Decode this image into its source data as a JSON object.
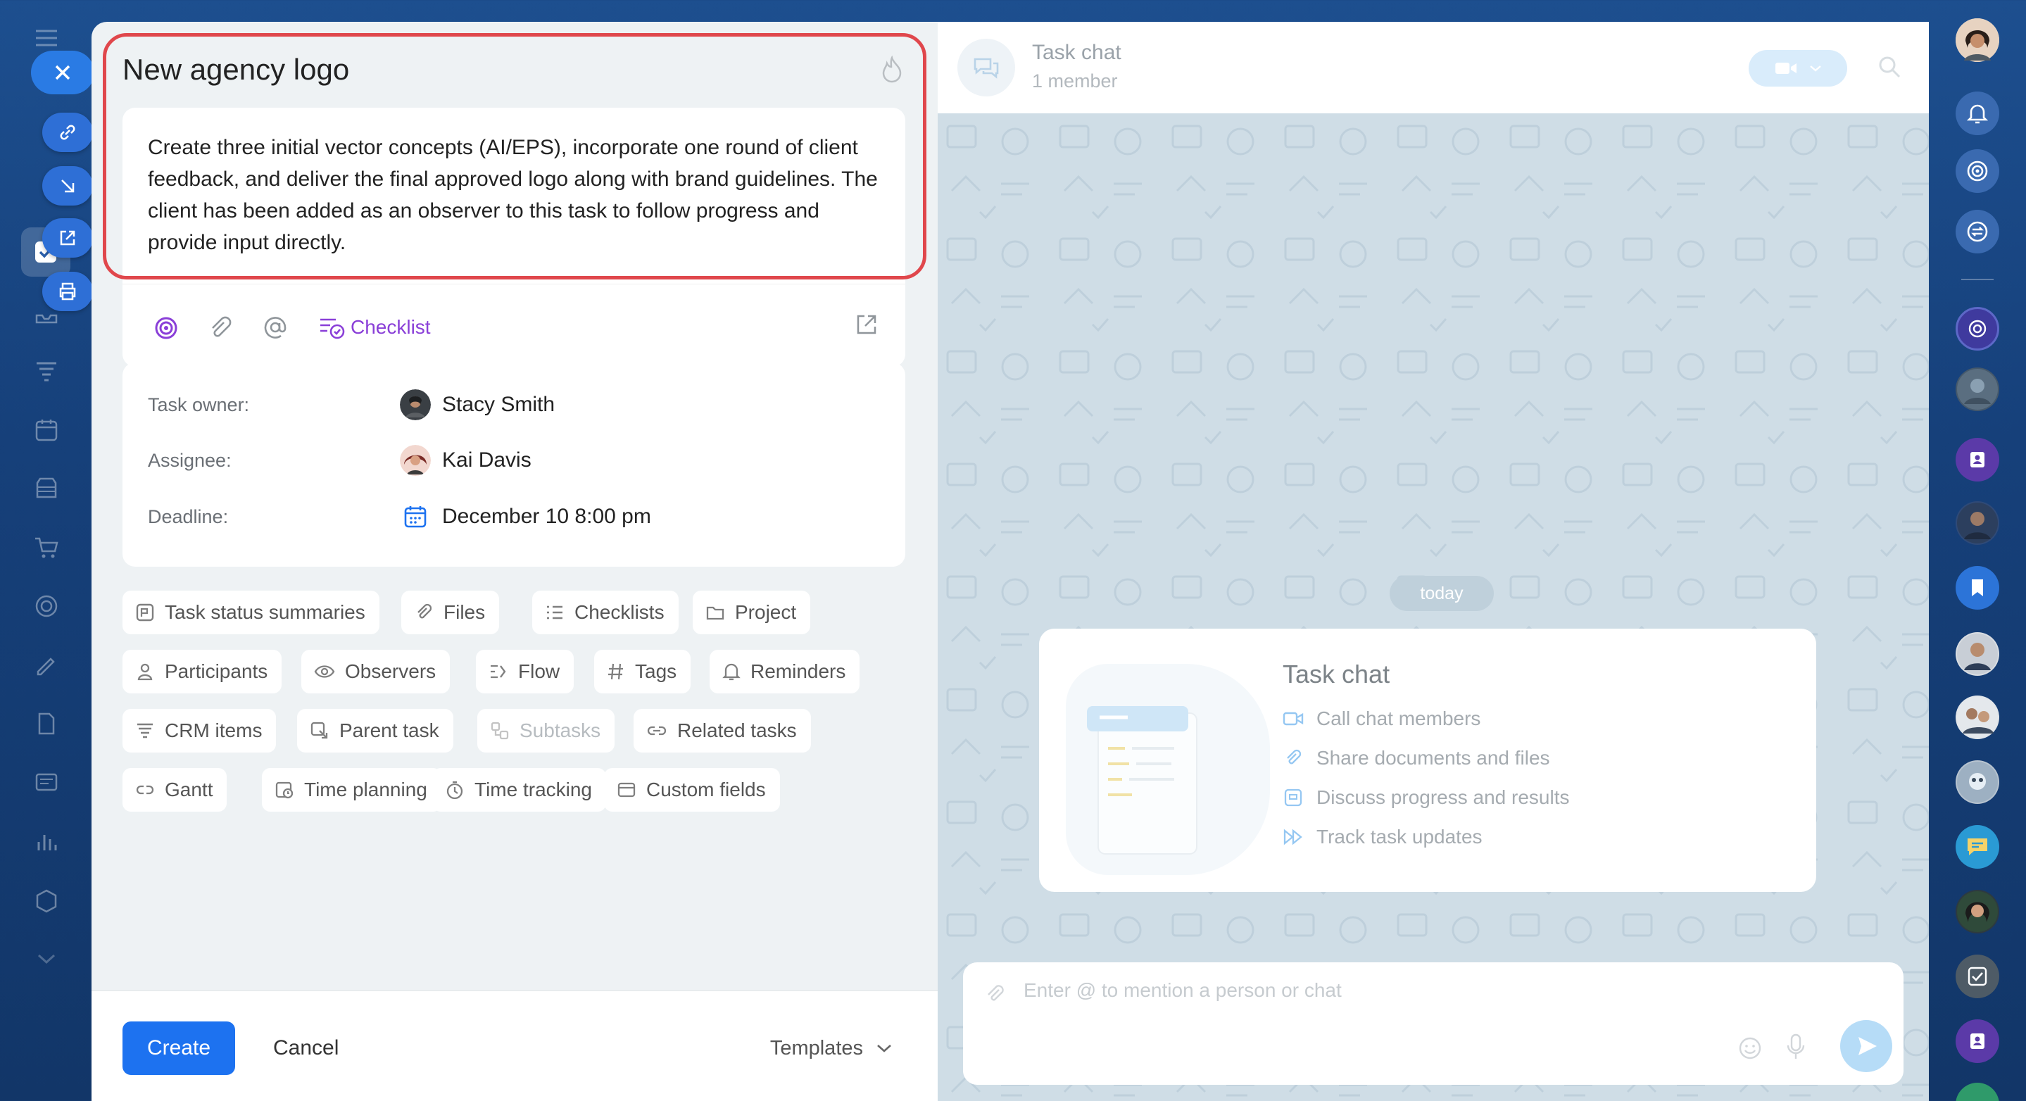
{
  "task": {
    "title": "New agency logo",
    "description": "Create three initial vector concepts (AI/EPS), incorporate one round of client feedback, and deliver the final approved logo along with brand guidelines. The client has been added as an observer to this task to follow progress and provide input directly.",
    "checklist_label": "Checklist"
  },
  "info": {
    "owner_label": "Task owner:",
    "owner_value": "Stacy Smith",
    "assignee_label": "Assignee:",
    "assignee_value": "Kai Davis",
    "deadline_label": "Deadline:",
    "deadline_value": "December 10 8:00 pm"
  },
  "chips": [
    {
      "label": "Task status summaries",
      "icon": "status-summary-icon",
      "enabled": true
    },
    {
      "label": "Files",
      "icon": "paperclip-icon",
      "enabled": true
    },
    {
      "label": "Checklists",
      "icon": "checklist-icon",
      "enabled": true
    },
    {
      "label": "Project",
      "icon": "folder-icon",
      "enabled": true
    },
    {
      "label": "Participants",
      "icon": "person-icon",
      "enabled": true
    },
    {
      "label": "Observers",
      "icon": "eye-icon",
      "enabled": true
    },
    {
      "label": "Flow",
      "icon": "flow-icon",
      "enabled": true
    },
    {
      "label": "Tags",
      "icon": "hash-icon",
      "enabled": true
    },
    {
      "label": "Reminders",
      "icon": "bell-icon",
      "enabled": true
    },
    {
      "label": "CRM items",
      "icon": "crm-icon",
      "enabled": true
    },
    {
      "label": "Parent task",
      "icon": "parent-task-icon",
      "enabled": true
    },
    {
      "label": "Subtasks",
      "icon": "subtasks-icon",
      "enabled": false
    },
    {
      "label": "Related tasks",
      "icon": "link-icon",
      "enabled": true
    },
    {
      "label": "Gantt",
      "icon": "gantt-icon",
      "enabled": true
    },
    {
      "label": "Time planning",
      "icon": "calendar-clock-icon",
      "enabled": true
    },
    {
      "label": "Time tracking",
      "icon": "stopwatch-icon",
      "enabled": true
    },
    {
      "label": "Custom fields",
      "icon": "custom-fields-icon",
      "enabled": true
    }
  ],
  "footer": {
    "create_label": "Create",
    "cancel_label": "Cancel",
    "templates_label": "Templates"
  },
  "chat": {
    "title": "Task chat",
    "members": "1 member",
    "date_divider": "today",
    "card_title": "Task chat",
    "features": [
      {
        "label": "Call chat members",
        "icon": "video-icon"
      },
      {
        "label": "Share documents and files",
        "icon": "paperclip-icon"
      },
      {
        "label": "Discuss progress and results",
        "icon": "chat-icon"
      },
      {
        "label": "Track task updates",
        "icon": "fast-forward-icon"
      }
    ],
    "input_placeholder": "Enter @ to mention a person or chat"
  },
  "colors": {
    "accent": "#1d72f0",
    "highlight": "#e0474c",
    "checklist": "#8a3fd8",
    "background": "#16407a"
  }
}
